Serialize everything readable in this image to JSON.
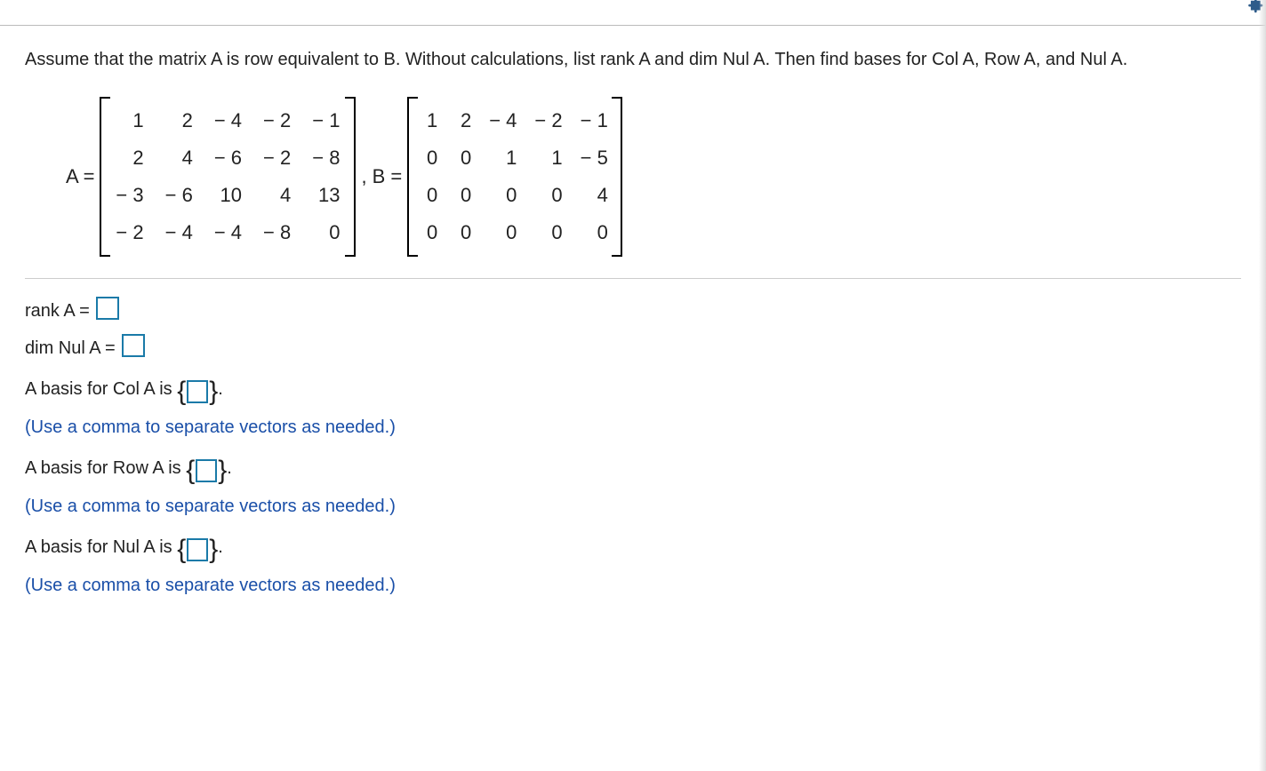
{
  "question": "Assume that the matrix A is row equivalent to B. Without calculations, list rank A and dim Nul A. Then find bases for Col A, Row A, and Nul A.",
  "labelA": "A =",
  "labelB": "B =",
  "comma": ",",
  "matrixA": [
    [
      "1",
      "2",
      "− 4",
      "− 2",
      "− 1"
    ],
    [
      "2",
      "4",
      "− 6",
      "− 2",
      "− 8"
    ],
    [
      "− 3",
      "− 6",
      "10",
      "4",
      "13"
    ],
    [
      "− 2",
      "− 4",
      "− 4",
      "− 8",
      "0"
    ]
  ],
  "matrixB": [
    [
      "1",
      "2",
      "− 4",
      "− 2",
      "− 1"
    ],
    [
      "0",
      "0",
      "1",
      "1",
      "− 5"
    ],
    [
      "0",
      "0",
      "0",
      "0",
      "4"
    ],
    [
      "0",
      "0",
      "0",
      "0",
      "0"
    ]
  ],
  "answers": {
    "rank_label": "rank A =",
    "dimnul_label": "dim Nul A =",
    "col_label": "A basis for Col A is ",
    "row_label": "A basis for Row A is ",
    "nul_label": "A basis for Nul A is ",
    "period": ".",
    "hint": "(Use a comma to separate vectors as needed.)"
  }
}
